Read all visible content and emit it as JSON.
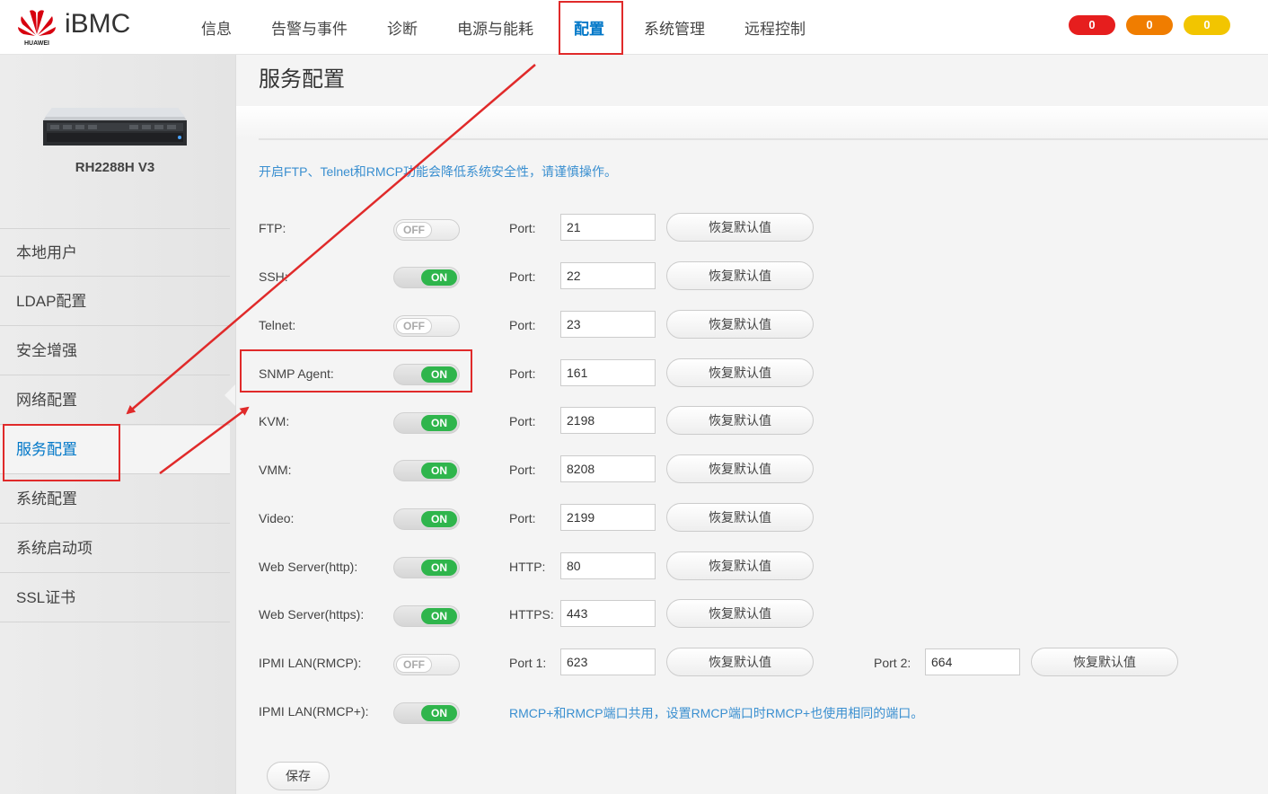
{
  "header": {
    "brand": "HUAWEI",
    "app_name": "iBMC",
    "nav": [
      "信息",
      "告警与事件",
      "诊断",
      "电源与能耗",
      "配置",
      "系统管理",
      "远程控制"
    ],
    "active_nav": "配置",
    "alarms": [
      {
        "count": "0",
        "color": "#e61e1e"
      },
      {
        "count": "0",
        "color": "#f07d00"
      },
      {
        "count": "0",
        "color": "#f2c500"
      }
    ]
  },
  "sidebar": {
    "model": "RH2288H V3",
    "items": [
      "本地用户",
      "LDAP配置",
      "安全增强",
      "网络配置",
      "服务配置",
      "系统配置",
      "系统启动项",
      "SSL证书"
    ],
    "active": "服务配置"
  },
  "main": {
    "title": "服务配置",
    "notice": "开启FTP、Telnet和RMCP功能会降低系统安全性，请谨慎操作。",
    "on_label": "ON",
    "off_label": "OFF",
    "restore_label": "恢复默认值",
    "services": [
      {
        "name": "FTP:",
        "state": "OFF",
        "port_label": "Port:",
        "port": "21"
      },
      {
        "name": "SSH:",
        "state": "ON",
        "port_label": "Port:",
        "port": "22"
      },
      {
        "name": "Telnet:",
        "state": "OFF",
        "port_label": "Port:",
        "port": "23"
      },
      {
        "name": "SNMP Agent:",
        "state": "ON",
        "port_label": "Port:",
        "port": "161"
      },
      {
        "name": "KVM:",
        "state": "ON",
        "port_label": "Port:",
        "port": "2198"
      },
      {
        "name": "VMM:",
        "state": "ON",
        "port_label": "Port:",
        "port": "8208"
      },
      {
        "name": "Video:",
        "state": "ON",
        "port_label": "Port:",
        "port": "2199"
      },
      {
        "name": "Web Server(http):",
        "state": "ON",
        "port_label": "HTTP:",
        "port": "80"
      },
      {
        "name": "Web Server(https):",
        "state": "ON",
        "port_label": "HTTPS:",
        "port": "443"
      },
      {
        "name": "IPMI LAN(RMCP):",
        "state": "OFF",
        "port_label": "Port 1:",
        "port": "623",
        "port2_label": "Port 2:",
        "port2": "664"
      },
      {
        "name": "IPMI LAN(RMCP+):",
        "state": "ON"
      }
    ],
    "rmcp_note": "RMCP+和RMCP端口共用，设置RMCP端口时RMCP+也使用相同的端口。",
    "save_label": "保存"
  },
  "annotation_color": "#e02a2a"
}
